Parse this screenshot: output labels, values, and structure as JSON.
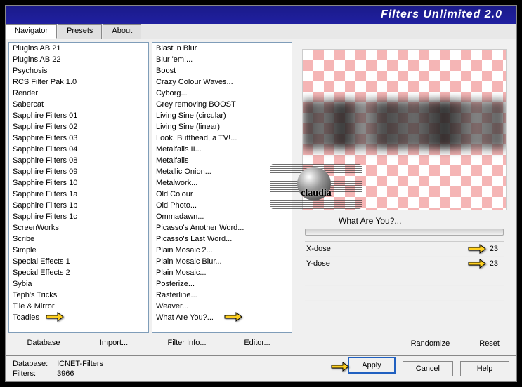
{
  "title": "Filters Unlimited 2.0",
  "tabs": [
    "Navigator",
    "Presets",
    "About"
  ],
  "activeTab": 0,
  "categories": [
    "Plugins AB 21",
    "Plugins AB 22",
    "Psychosis",
    "RCS Filter Pak 1.0",
    "Render",
    "Sabercat",
    "Sapphire Filters 01",
    "Sapphire Filters 02",
    "Sapphire Filters 03",
    "Sapphire Filters 04",
    "Sapphire Filters 08",
    "Sapphire Filters 09",
    "Sapphire Filters 10",
    "Sapphire Filters 1a",
    "Sapphire Filters 1b",
    "Sapphire Filters 1c",
    "ScreenWorks",
    "Scribe",
    "Simple",
    "Special Effects 1",
    "Special Effects 2",
    "Sybia",
    "Teph's Tricks",
    "Tile & Mirror",
    "Toadies"
  ],
  "filters": [
    "Blast 'n Blur",
    "Blur 'em!...",
    "Boost",
    "Crazy Colour Waves...",
    "Cyborg...",
    "Grey removing BOOST",
    "Living Sine (circular)",
    "Living Sine (linear)",
    "Look, Butthead, a TV!...",
    "Metalfalls II...",
    "Metalfalls",
    "Metallic Onion...",
    "Metalwork...",
    "Old Colour",
    "Old Photo...",
    "Ommadawn...",
    "Picasso's Another Word...",
    "Picasso's Last Word...",
    "Plain Mosaic 2...",
    "Plain Mosaic Blur...",
    "Plain Mosaic...",
    "Posterize...",
    "Rasterline...",
    "Weaver...",
    "What Are You?..."
  ],
  "listButtons": {
    "database": "Database",
    "import": "Import...",
    "filterInfo": "Filter Info...",
    "editor": "Editor..."
  },
  "currentFilter": "What Are You?...",
  "params": [
    {
      "label": "X-dose",
      "value": 23
    },
    {
      "label": "Y-dose",
      "value": 23
    }
  ],
  "rightButtons": {
    "randomize": "Randomize",
    "reset": "Reset"
  },
  "footer": {
    "databaseLabel": "Database:",
    "databaseValue": "ICNET-Filters",
    "filtersLabel": "Filters:",
    "filtersValue": "3966",
    "apply": "Apply",
    "cancel": "Cancel",
    "help": "Help"
  },
  "watermark": "claudia"
}
